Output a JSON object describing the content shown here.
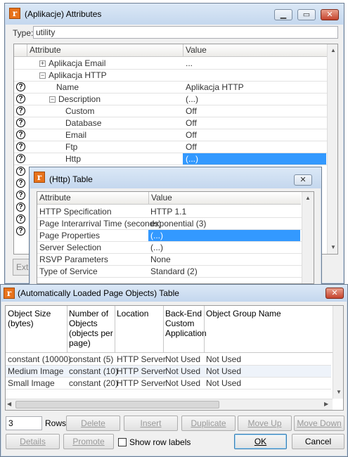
{
  "win1": {
    "title": "(Aplikacje) Attributes",
    "type_label": "Type:",
    "type_value": "utility",
    "col_attr": "Attribute",
    "col_value": "Value",
    "rows": [
      {
        "label": "Aplikacja Email",
        "value": "..."
      },
      {
        "label": "Aplikacja HTTP",
        "value": ""
      },
      {
        "label": "Name",
        "value": "Aplikacja HTTP"
      },
      {
        "label": "Description",
        "value": "(...)"
      },
      {
        "label": "Custom",
        "value": "Off"
      },
      {
        "label": "Database",
        "value": "Off"
      },
      {
        "label": "Email",
        "value": "Off"
      },
      {
        "label": "Ftp",
        "value": "Off"
      },
      {
        "label": "Http",
        "value": "(...)"
      }
    ],
    "ext_label": "Ext"
  },
  "win2": {
    "title": "(Http) Table",
    "col_attr": "Attribute",
    "col_value": "Value",
    "rows": [
      {
        "label": "HTTP Specification",
        "value": "HTTP 1.1"
      },
      {
        "label": "Page Interarrival Time (seconds)",
        "value": "exponential (3)"
      },
      {
        "label": "Page Properties",
        "value": "(...)"
      },
      {
        "label": "Server Selection",
        "value": "(...)"
      },
      {
        "label": "RSVP Parameters",
        "value": "None"
      },
      {
        "label": "Type of Service",
        "value": "Standard (2)"
      }
    ]
  },
  "win3": {
    "title": "(Automatically Loaded Page Objects) Table",
    "headers": [
      "Object Size (bytes)",
      "Number of Objects (objects per page)",
      "Location",
      "Back-End Custom Application",
      "Object Group Name"
    ],
    "rows": [
      [
        "constant (10000)",
        "constant (5)",
        "HTTP Server",
        "Not Used",
        "Not Used"
      ],
      [
        "Medium Image",
        "constant (10)",
        "HTTP Server",
        "Not Used",
        "Not Used"
      ],
      [
        "Small Image",
        "constant (20)",
        "HTTP Server",
        "Not Used",
        "Not Used"
      ]
    ],
    "rows_value": "3",
    "rows_label": "Rows",
    "buttons": {
      "delete": "Delete",
      "insert": "Insert",
      "duplicate": "Duplicate",
      "move_up": "Move Up",
      "move_down": "Move Down",
      "details": "Details",
      "promote": "Promote",
      "ok": "OK",
      "cancel": "Cancel"
    },
    "show_row_labels": "Show row labels"
  }
}
